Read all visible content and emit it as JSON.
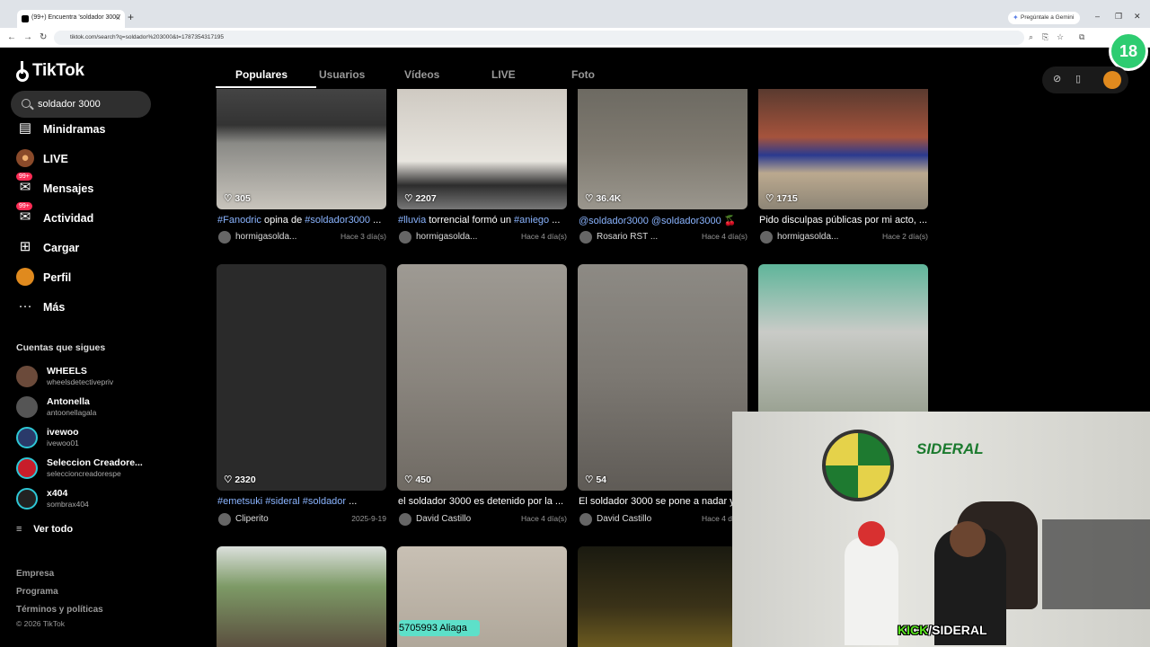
{
  "browser": {
    "tab_title": "(99+) Encuentra 'soldador 3000'",
    "new_tab": "+",
    "gemini": "Pregúntale a Gemini",
    "url": "tiktok.com/search?q=soldador%203000&t=1787354317195",
    "window_min": "–",
    "window_max": "❐",
    "window_close": "✕"
  },
  "overlay_badge": "18",
  "sidebar": {
    "logo": "TikTok",
    "search_value": "soldador 3000",
    "items": [
      {
        "label": "Minidramas",
        "icon": "▤"
      },
      {
        "label": "LIVE",
        "icon": "●"
      },
      {
        "label": "Mensajes",
        "icon": "✉",
        "count": "99+"
      },
      {
        "label": "Actividad",
        "icon": "✉",
        "count": "99+"
      },
      {
        "label": "Cargar",
        "icon": "⊞"
      },
      {
        "label": "Perfil",
        "icon": "●"
      },
      {
        "label": "Más",
        "icon": "···"
      }
    ],
    "following_title": "Cuentas que sigues",
    "following": [
      {
        "name": "WHEELS",
        "handle": "wheelsdetectivepriv",
        "color": "#6b4a3a"
      },
      {
        "name": "Antonella",
        "handle": "antoonellagala",
        "color": "#444444"
      },
      {
        "name": "ivewoo",
        "handle": "ivewoo01",
        "color": "#2a3a6a"
      },
      {
        "name": "Seleccion Creadore...",
        "handle": "seleccioncreadorespe",
        "color": "#c81d2a"
      },
      {
        "name": "x404",
        "handle": "sombrax404",
        "color": "#222222"
      }
    ],
    "see_all": "Ver todo",
    "footer": [
      "Empresa",
      "Programa",
      "Términos y políticas"
    ],
    "copyright": "© 2026 TikTok"
  },
  "tabs": [
    "Populares",
    "Usuarios",
    "Vídeos",
    "LIVE",
    "Foto"
  ],
  "videos": [
    {
      "likes": "305",
      "caption_parts": [
        {
          "t": "#Fanodric",
          "tag": true
        },
        {
          "t": " opina de ",
          "tag": false
        },
        {
          "t": "#soldador3000",
          "tag": true
        },
        {
          "t": " ...",
          "tag": false
        }
      ],
      "user": "hormigasolda...",
      "date": "Hace 3 día(s)",
      "bg": "linear-gradient(#444 0%,#333 30%,#8a8a86 45%,#c8c4bc 100%)"
    },
    {
      "likes": "2207",
      "caption_parts": [
        {
          "t": "#lluvia",
          "tag": true
        },
        {
          "t": " torrencial formó un ",
          "tag": false
        },
        {
          "t": "#aniego",
          "tag": true
        },
        {
          "t": " ...",
          "tag": false
        }
      ],
      "user": "hormigasolda...",
      "date": "Hace 4 día(s)",
      "bg": "linear-gradient(#cfcac2 0%,#e8e5df 60%,#2d2d2d 80%,#777 100%)"
    },
    {
      "likes": "36.4K",
      "caption_parts": [
        {
          "t": "@soldador3000 @soldador3000",
          "tag": true
        },
        {
          "t": " 🍒",
          "tag": false
        }
      ],
      "user": "Rosario RST ...",
      "date": "Hace 4 día(s)",
      "bg": "linear-gradient(#6d6a62 0%,#7f7a70 50%,#9a968d 100%)"
    },
    {
      "likes": "1715",
      "caption_parts": [
        {
          "t": "Pido disculpas públicas por mi acto, ...",
          "tag": false
        }
      ],
      "user": "hormigasolda...",
      "date": "Hace 2 día(s)",
      "bg": "linear-gradient(#5a3a2f 0%,#a5533c 40%,#2b3a8f 55%,#bba98f 70%,#8d8576 100%)"
    },
    {
      "likes": "2320",
      "caption_parts": [
        {
          "t": "#emetsuki #sideral #soldador",
          "tag": true
        },
        {
          "t": " ...",
          "tag": false
        }
      ],
      "user": "Cliperito",
      "date": "2025-9-19",
      "bg": "#2a2a2a"
    },
    {
      "likes": "450",
      "caption_parts": [
        {
          "t": "el soldador 3000 es detenido por la ...",
          "tag": false
        }
      ],
      "user": "David Castillo",
      "date": "Hace 4 día(s)",
      "bg": "linear-gradient(#9e9a93 0%,#8a857e 50%,#6f6a63 100%)"
    },
    {
      "likes": "54",
      "caption_parts": [
        {
          "t": "El soldador 3000 se pone a nadar y ...",
          "tag": false
        }
      ],
      "user": "David Castillo",
      "date": "Hace 4 día(s)",
      "bg": "linear-gradient(#8d8a84 0%,#7c7872 50%,#5f5b56 100%)"
    },
    {
      "likes": "",
      "caption_parts": [],
      "user": "",
      "date": "",
      "bg": "linear-gradient(#5fb59a 0%,#c9cbc7 30%,#6d7a60 100%)"
    },
    {
      "likes": "",
      "caption_parts": [],
      "user": "",
      "date": "",
      "bg": "linear-gradient(#dbe0dc 0%,#7d9a66 40%,#5b4f3f 100%)"
    },
    {
      "likes": "",
      "caption_parts": [],
      "user": "",
      "date": "",
      "bg": "linear-gradient(#c8c0b4 0%,#b0a79a 100%)"
    },
    {
      "likes": "",
      "caption_parts": [],
      "user": "",
      "date": "",
      "bg": "linear-gradient(#1a1a10 0%,#3a3218 60%,#6b5a20 100%)"
    }
  ],
  "tag_pill": "5705993 Aliaga",
  "stream": {
    "logo": "SIDERAL",
    "kick_a": "KICK",
    "kick_b": "/SIDERAL"
  }
}
